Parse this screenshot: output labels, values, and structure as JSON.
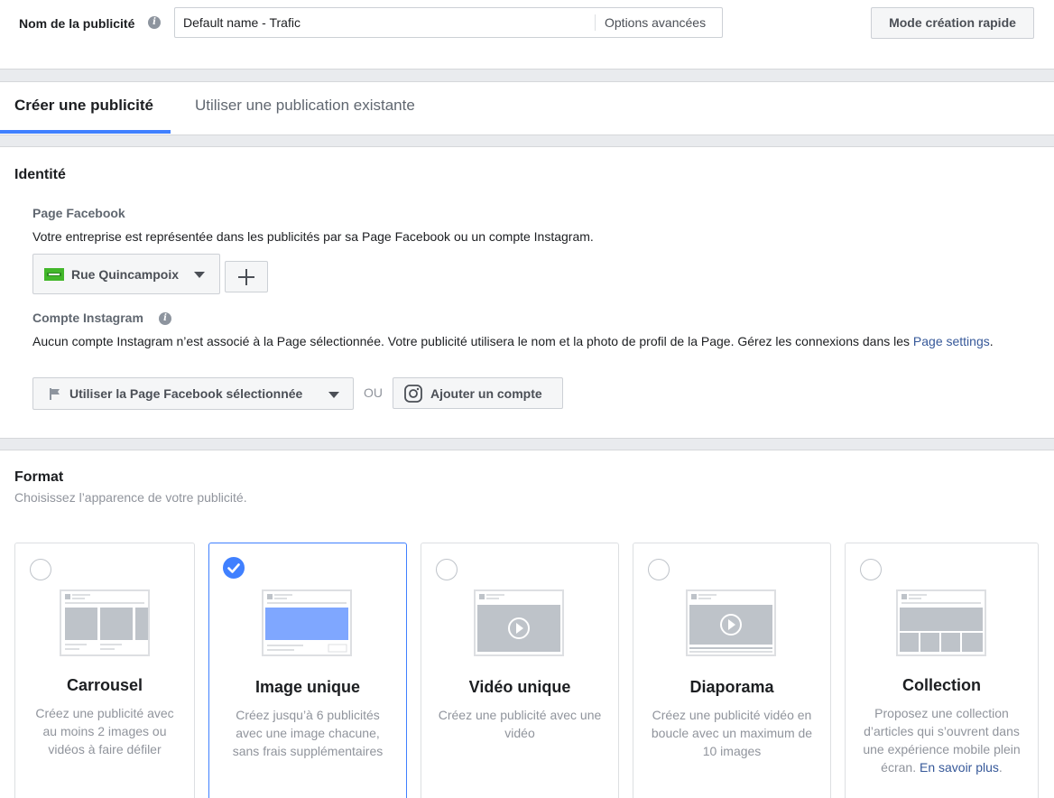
{
  "header": {
    "ad_name_label": "Nom de la publicité",
    "ad_name_value": "Default name - Trafic",
    "advanced_options": "Options avancées",
    "quick_creation": "Mode création rapide"
  },
  "tabs": [
    {
      "label": "Créer une publicité",
      "active": true
    },
    {
      "label": "Utiliser une publication existante",
      "active": false
    }
  ],
  "identity": {
    "title": "Identité",
    "facebook_page": {
      "label": "Page Facebook",
      "description": "Votre entreprise est représentée dans les publicités par sa Page Facebook ou un compte Instagram.",
      "selected_page": "Rue Quincampoix"
    },
    "instagram": {
      "label": "Compte Instagram",
      "description": "Aucun compte Instagram n’est associé à la Page sélectionnée. Votre publicité utilisera le nom et la photo de profil de la Page. Gérez les connexions dans les ",
      "link_text": "Page settings",
      "period": ".",
      "use_page_button": "Utiliser la Page Facebook sélectionnée",
      "or": "OU",
      "add_account_button": "Ajouter un compte"
    }
  },
  "format": {
    "title": "Format",
    "subtitle": "Choisissez l’apparence de votre publicité.",
    "options": [
      {
        "title": "Carrousel",
        "description": "Créez une publicité avec au moins 2 images ou vidéos à faire défiler",
        "selected": false
      },
      {
        "title": "Image unique",
        "description": "Créez jusqu’à 6 publicités avec une image chacune, sans frais supplémentaires",
        "selected": true
      },
      {
        "title": "Vidéo unique",
        "description": "Créez une publicité avec une vidéo",
        "selected": false
      },
      {
        "title": "Diaporama",
        "description": "Créez une publicité vidéo en boucle avec un maximum de 10 images",
        "selected": false
      },
      {
        "title": "Collection",
        "description": "Proposez une collection d’articles qui s’ouvrent dans une expérience mobile plein écran. ",
        "link_text": "En savoir plus",
        "period": ".",
        "selected": false
      }
    ]
  },
  "colors": {
    "accent": "#4080ff",
    "link": "#365899",
    "page_icon": "#42b72a"
  }
}
